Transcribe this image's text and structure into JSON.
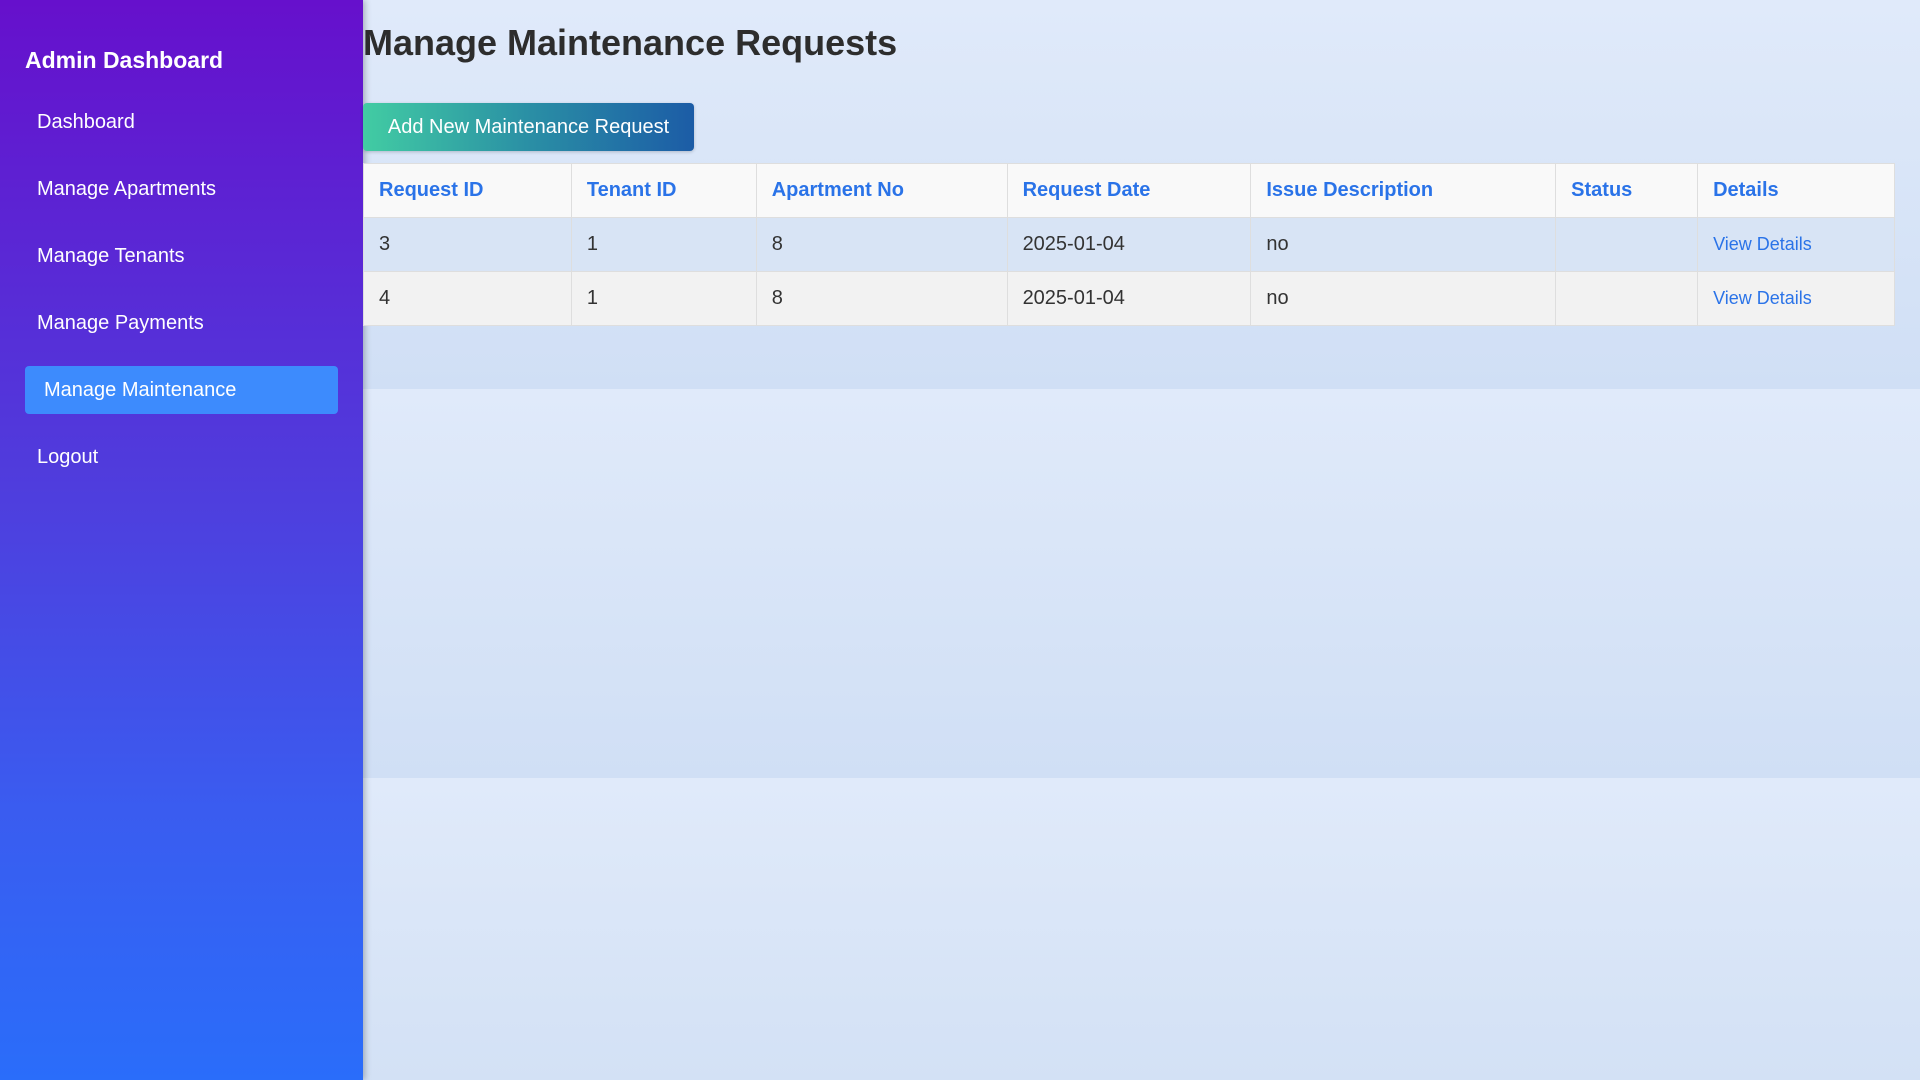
{
  "sidebar": {
    "title": "Admin Dashboard",
    "items": [
      {
        "label": "Dashboard"
      },
      {
        "label": "Manage Apartments"
      },
      {
        "label": "Manage Tenants"
      },
      {
        "label": "Manage Payments"
      },
      {
        "label": "Manage Maintenance",
        "active": true
      },
      {
        "label": "Logout"
      }
    ]
  },
  "main": {
    "title": "Manage Maintenance Requests",
    "add_button_label": "Add New Maintenance Request",
    "table": {
      "headers": [
        "Request ID",
        "Tenant ID",
        "Apartment No",
        "Request Date",
        "Issue Description",
        "Status",
        "Details"
      ],
      "rows": [
        {
          "request_id": "3",
          "tenant_id": "1",
          "apartment_no": "8",
          "request_date": "2025-01-04",
          "issue_description": "no",
          "status": "",
          "details": "View Details"
        },
        {
          "request_id": "4",
          "tenant_id": "1",
          "apartment_no": "8",
          "request_date": "2025-01-04",
          "issue_description": "no",
          "status": "",
          "details": "View Details"
        }
      ]
    }
  },
  "colors": {
    "sidebar_top": "#6610cc",
    "sidebar_bottom": "#2a6dfa",
    "active_item": "#3d8bfd",
    "header_text": "#2a73e8",
    "button_start": "#42cca3",
    "button_end": "#1c5ca6"
  }
}
